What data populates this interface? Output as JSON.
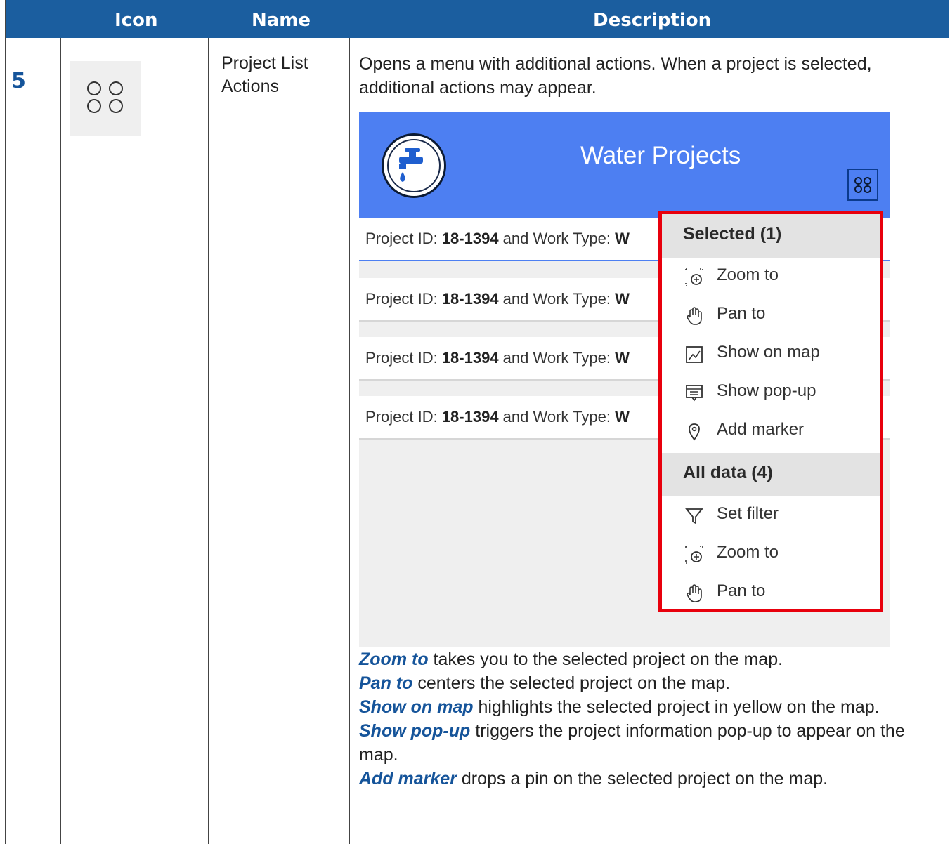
{
  "header": {
    "col_icon": "Icon",
    "col_name": "Name",
    "col_desc": "Description"
  },
  "row": {
    "number": "5",
    "icon_name": "actions-grid-icon",
    "name_line1": "Project List",
    "name_line2": "Actions",
    "description": "Opens a menu with additional actions. When a project is selected, additional actions may appear."
  },
  "screenshot": {
    "app_title": "Water Projects",
    "list_rows": [
      {
        "label": "Project ID: ",
        "id": "18-1394",
        "mid": " and Work Type: ",
        "tail": "W",
        "selected": true
      },
      {
        "label": "Project ID: ",
        "id": "18-1394",
        "mid": " and Work Type: ",
        "tail": "W",
        "selected": false
      },
      {
        "label": "Project ID: ",
        "id": "18-1394",
        "mid": " and Work Type: ",
        "tail": "W",
        "selected": false
      },
      {
        "label": "Project ID: ",
        "id": "18-1394",
        "mid": " and Work Type: ",
        "tail": "W",
        "selected": false
      }
    ],
    "menu": {
      "selected_header": "Selected (1)",
      "selected_items": [
        {
          "label": "Zoom to",
          "icon": "zoom-to-icon"
        },
        {
          "label": "Pan to",
          "icon": "pan-hand-icon"
        },
        {
          "label": "Show on map",
          "icon": "show-on-map-icon"
        },
        {
          "label": "Show pop-up",
          "icon": "popup-icon"
        },
        {
          "label": "Add marker",
          "icon": "marker-icon"
        }
      ],
      "all_header": "All data (4)",
      "all_items": [
        {
          "label": "Set filter",
          "icon": "filter-icon"
        },
        {
          "label": "Zoom to",
          "icon": "zoom-to-icon"
        },
        {
          "label": "Pan to",
          "icon": "pan-hand-icon"
        }
      ],
      "highlight_color": "#e8000d"
    }
  },
  "explanations": [
    {
      "term": "Zoom to",
      "text": " takes you to the selected project on the map."
    },
    {
      "term": "Pan to",
      "text": " centers the selected project on the map."
    },
    {
      "term": "Show on map",
      "text": " highlights the selected project in yellow on the map."
    },
    {
      "term": "Show pop-up",
      "text": " triggers the project information pop-up to appear on the map."
    },
    {
      "term": "Add marker",
      "text": " drops a pin on the selected project on the map."
    }
  ],
  "colors": {
    "header_bg": "#1b5e9f",
    "accent_text": "#15549a",
    "app_banner": "#4d7ff2"
  }
}
